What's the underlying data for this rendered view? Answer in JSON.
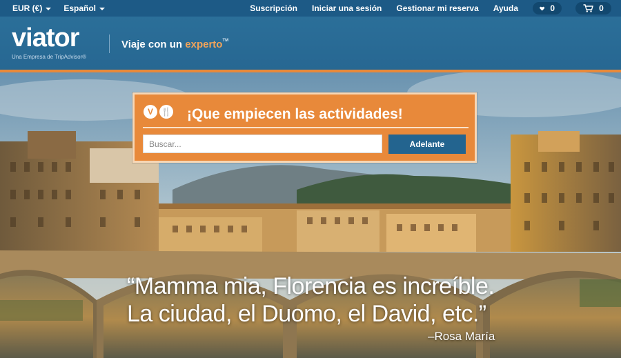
{
  "topbar": {
    "currency": "EUR (€)",
    "language": "Español",
    "links": [
      "Suscripción",
      "Iniciar una sesión",
      "Gestionar mi reserva",
      "Ayuda"
    ],
    "favorites_count": "0",
    "cart_count": "0"
  },
  "header": {
    "logo": "viator",
    "logo_subtitle": "Una Empresa de TripAdvisor®",
    "tagline_prefix": "Viaje con un",
    "tagline_accent": "experto",
    "tagline_tm": "TM"
  },
  "search": {
    "icon_labels": [
      "V",
      "🍴"
    ],
    "title": "¡Que empiecen las actividades!",
    "placeholder": "Buscar...",
    "button_label": "Adelante"
  },
  "hero": {
    "quote_line1": "“Mamma mia, Florencia es increíble.",
    "quote_line2": "La ciudad, el Duomo, el David, etc.”",
    "author": "–Rosa María"
  },
  "colors": {
    "brand_blue": "#2b6f99",
    "topbar_blue": "#1d5a86",
    "accent_orange": "#e8893a",
    "button_blue": "#23648f"
  },
  "icons": [
    "caret-down-icon",
    "heart-icon",
    "cart-icon",
    "viator-v-icon",
    "fork-knife-icon"
  ]
}
